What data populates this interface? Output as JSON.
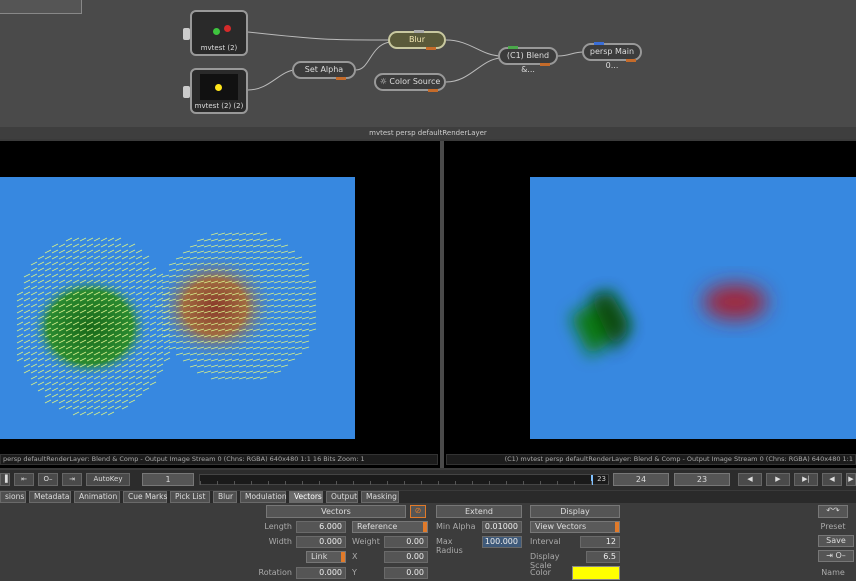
{
  "node_graph": {
    "nodes": {
      "mvtest_2": "mvtest (2)",
      "mvtest_2_2": "mvtest (2) (2)",
      "set_alpha": "Set Alpha",
      "blur": "Blur",
      "color_source": "Color Source",
      "blend_comp": "(C1) Blend &...",
      "persp_main": "persp Main 0..."
    },
    "caption": "mvtest persp defaultRenderLayer"
  },
  "viewers": {
    "left_status": "persp defaultRenderLayer: Blend & Comp - Output Image  Stream 0 (Chns: RGBA)  640x480  1:1  16 Bits  Zoom: 1",
    "right_status": "(C1) mvtest persp defaultRenderLayer: Blend & Comp - Output Image  Stream 0 (Chns: RGBA)  640x480  1:1"
  },
  "timeline": {
    "autokey_label": "AutoKey",
    "start_frame": "1",
    "marker_frame": "23",
    "current_frame": "24",
    "end_frame": "23",
    "range_max": 24,
    "cursor_value": 23
  },
  "tabs": [
    "sions",
    "Metadata",
    "Animation",
    "Cue Marks",
    "Pick List",
    "Blur",
    "Modulation",
    "Vectors",
    "Output",
    "Masking"
  ],
  "active_tab": "Vectors",
  "params": {
    "vectors_header": "Vectors",
    "extend_header": "Extend",
    "display_header": "Display",
    "length_label": "Length",
    "length_value": "6.000",
    "reference_label": "Reference",
    "width_label": "Width",
    "width_value": "0.000",
    "weight_label": "Weight",
    "weight_value": "0.00",
    "link_label": "Link",
    "x_label": "X",
    "x_value": "0.00",
    "rotation_label": "Rotation",
    "rotation_value": "0.000",
    "y_label": "Y",
    "y_value": "0.00",
    "min_alpha_label": "Min Alpha",
    "min_alpha_value": "0.01000",
    "max_radius_label": "Max Radius",
    "max_radius_value": "100.000",
    "view_vectors_label": "View Vectors",
    "interval_label": "Interval",
    "interval_value": "12",
    "display_scale_label": "Display Scale",
    "display_scale_value": "6.5",
    "color_label": "Color",
    "color_value": "#ffff00",
    "preset_label": "Preset",
    "save_label": "Save",
    "name_label": "Name"
  },
  "colors": {
    "frame_blue": "#3788e0",
    "vector_yellow": "#d6f08a",
    "accent_orange": "#e07a2a"
  }
}
